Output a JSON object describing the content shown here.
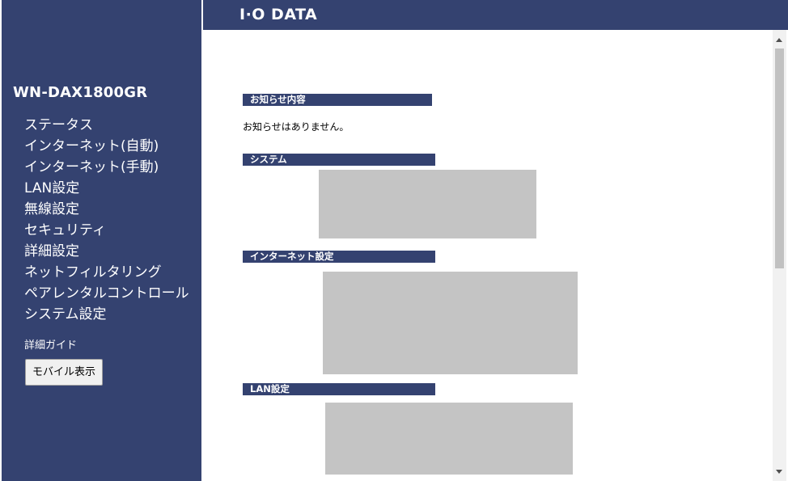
{
  "brand": {
    "logo": "I·O DATA"
  },
  "sidebar": {
    "model": "WN-DAX1800GR",
    "items": [
      {
        "label": "ステータス"
      },
      {
        "label": "インターネット(自動)"
      },
      {
        "label": "インターネット(手動)"
      },
      {
        "label": "LAN設定"
      },
      {
        "label": "無線設定"
      },
      {
        "label": "セキュリティ"
      },
      {
        "label": "詳細設定"
      },
      {
        "label": "ネットフィルタリング"
      },
      {
        "label": "ペアレンタルコントロール"
      },
      {
        "label": "システム設定"
      }
    ],
    "guide_label": "詳細ガイド",
    "mobile_button": "モバイル表示"
  },
  "main": {
    "notice": {
      "title": "お知らせ内容",
      "text": "お知らせはありません。"
    },
    "system": {
      "title": "システム"
    },
    "internet": {
      "title": "インターネット設定"
    },
    "lan": {
      "title": "LAN設定"
    }
  },
  "colors": {
    "brand_navy": "#344270",
    "redaction_gray": "#c4c4c4"
  }
}
